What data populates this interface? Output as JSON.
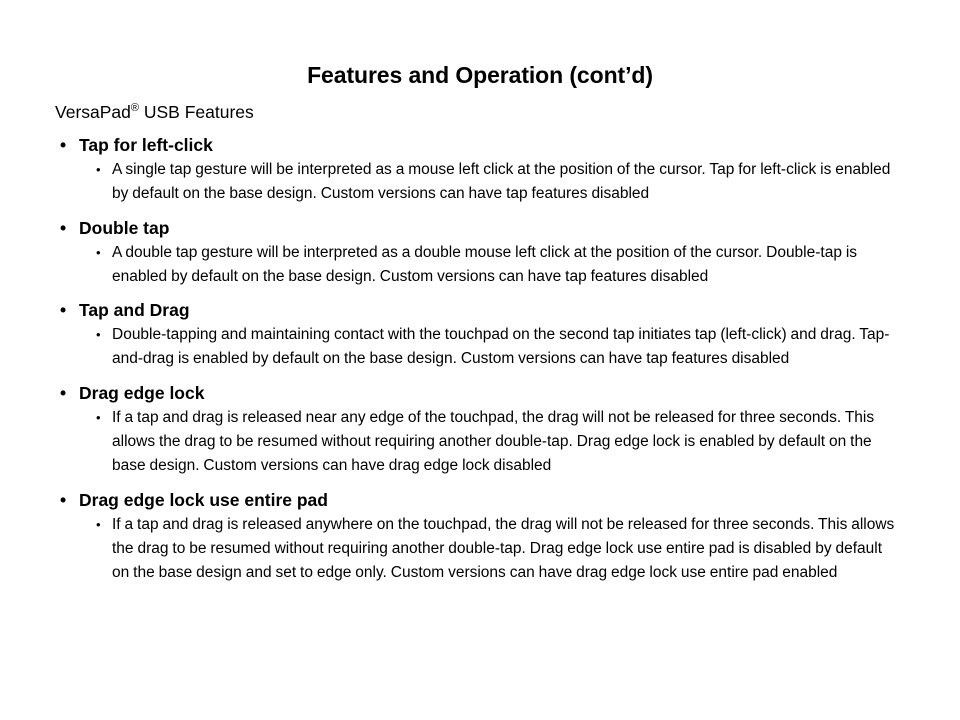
{
  "slide": {
    "title": "Features and Operation (cont’d)",
    "intro": {
      "prefix": "VersaPad",
      "superscript": "®",
      "suffix": " USB Features"
    },
    "bullet_glyph_level1": "•",
    "bullet_glyph_level2": "•",
    "sections": [
      {
        "heading": "Tap for left-click",
        "body": "A single tap gesture will be interpreted as a mouse left click at the position of the cursor. Tap for left-click is enabled by default on the base design. Custom versions can have tap features disabled"
      },
      {
        "heading": "Double tap",
        "body": "A double tap gesture will be interpreted as a double mouse left click at the position of the cursor. Double-tap is enabled by default on the base design. Custom versions can have tap features disabled"
      },
      {
        "heading": "Tap and Drag",
        "body": "Double-tapping and maintaining contact with the touchpad on the second tap initiates tap (left-click) and drag. Tap-and-drag is enabled by default on the base design. Custom versions can have tap features disabled"
      },
      {
        "heading": "Drag edge lock",
        "body": "If a tap and drag is released near any edge of the touchpad, the drag will not be released for three seconds. This allows the drag to be resumed without requiring another double-tap. Drag edge lock is enabled by default on the base design. Custom versions can have drag edge lock disabled"
      },
      {
        "heading": "Drag edge lock use entire pad",
        "body": "If a tap and drag is released anywhere on the touchpad, the drag will not be released for three seconds. This allows the drag to be resumed without requiring another double-tap. Drag edge lock use entire pad is disabled by default on the base design and set to edge only. Custom versions can have drag edge lock use entire pad enabled"
      }
    ],
    "colors": {
      "background": "#ffffff",
      "text": "#000000"
    }
  }
}
